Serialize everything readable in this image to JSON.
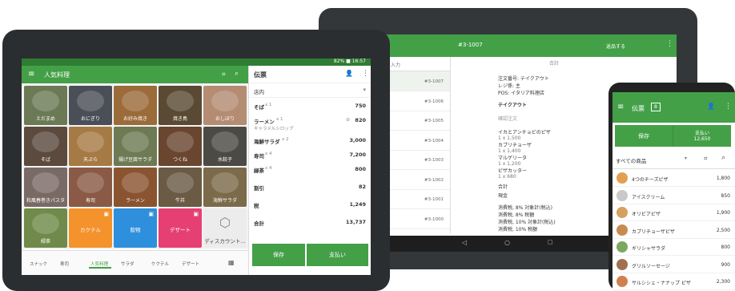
{
  "tablet": {
    "status_time": "82% ■ 16:57",
    "title": "人気料理",
    "grid": [
      {
        "label": "えだまめ",
        "color": "#6b7a55"
      },
      {
        "label": "おにぎり",
        "color": "#4a4e56"
      },
      {
        "label": "お好み焼き",
        "color": "#9b6b3a"
      },
      {
        "label": "焼き鳥",
        "color": "#5a4a33"
      },
      {
        "label": "おしぼり",
        "color": "#b38c72"
      },
      {
        "label": "そば",
        "color": "#5b4a3d"
      },
      {
        "label": "天ぷら",
        "color": "#a67a45"
      },
      {
        "label": "揚げ豆腐サラダ",
        "color": "#6e7a54"
      },
      {
        "label": "つくね",
        "color": "#6a4530"
      },
      {
        "label": "水餃子",
        "color": "#4c4a45"
      },
      {
        "label": "和風春巻きパスタ",
        "color": "#7a6a66"
      },
      {
        "label": "寿司",
        "color": "#8a5a46"
      },
      {
        "label": "ラーメン",
        "color": "#8a5430"
      },
      {
        "label": "牛丼",
        "color": "#6b5a44"
      },
      {
        "label": "海鮮サラダ",
        "color": "#7b6b4a"
      },
      {
        "label": "緑茶",
        "color": "#6f8a4a"
      },
      {
        "label": "カクテル",
        "color": "#f4922b"
      },
      {
        "label": "飲物",
        "color": "#2e8fdc"
      },
      {
        "label": "デザート",
        "color": "#e63f74"
      },
      {
        "label": "ディスカウント...",
        "color": "#ececec"
      }
    ],
    "tabs": [
      "スナック",
      "寿司",
      "人気料理",
      "サラダ",
      "ケクテル",
      "デザート"
    ],
    "active_tab": "人気料理",
    "ticket": {
      "title": "伝票",
      "dine": "店内",
      "items": [
        {
          "name": "そば",
          "qty": "x 1",
          "sub": "",
          "price": "750"
        },
        {
          "name": "ラーメン",
          "qty": "x 1",
          "sub": "キャラメルシロップ",
          "price": "820"
        },
        {
          "name": "海鮮サラダ",
          "qty": "x 2",
          "sub": "",
          "price": "3,000"
        },
        {
          "name": "寿司",
          "qty": "x 4",
          "sub": "",
          "price": "7,200"
        },
        {
          "name": "緑茶",
          "qty": "x 4",
          "sub": "",
          "price": "800"
        }
      ],
      "discount_label": "割引",
      "discount": "82",
      "tax_label": "税",
      "tax": "1,249",
      "total_label": "合計",
      "total": "13,737",
      "save": "保存",
      "pay": "支払い"
    }
  },
  "receipts": {
    "search_hint": "を入力",
    "header_id": "#3-1007",
    "refund": "返品する",
    "ids": [
      "#3-1007",
      "#3-1006",
      "#3-1005",
      "#3-1004",
      "#3-1003",
      "#3-1002",
      "#3-1001",
      "#3-1000"
    ],
    "total_head": "合計",
    "meta": [
      "注文番号: テイクアウト",
      "レジ係: 主",
      "POS: イタリア料理店"
    ],
    "type": "テイクアウト",
    "note": "確認注文",
    "lines": [
      {
        "name": "イカとアンチョビのピザ",
        "sub": "1 x 1,500"
      },
      {
        "name": "カプリチョーザ",
        "sub": "1 x 1,400"
      },
      {
        "name": "マルゲリータ",
        "sub": "1 x 1,200"
      },
      {
        "name": "ピザカッター",
        "sub": "1 x 680"
      }
    ],
    "sum_label": "合計",
    "cash_label": "現金",
    "tax_lines": [
      "消費税, 8% 対象計(税込)",
      "消費税, 8% 税額",
      "消費税, 10% 対象計(税込)",
      "消費税, 10% 税額"
    ]
  },
  "phone": {
    "title": "伝票",
    "badge": "8",
    "save": "保存",
    "pay_label": "支払い",
    "pay_amount": "12,650",
    "filter": "すべての商品",
    "items": [
      {
        "name": "4つのチーズピザ",
        "price": "1,800"
      },
      {
        "name": "アイスクリーム",
        "price": "850"
      },
      {
        "name": "オリビアピザ",
        "price": "1,900"
      },
      {
        "name": "カプリチョーザピザ",
        "price": "2,500"
      },
      {
        "name": "ギリシャサラダ",
        "price": "800"
      },
      {
        "name": "グリルソーセージ",
        "price": "900"
      },
      {
        "name": "サルシシェ・ナナップ ピザ",
        "price": "2,300"
      }
    ]
  }
}
